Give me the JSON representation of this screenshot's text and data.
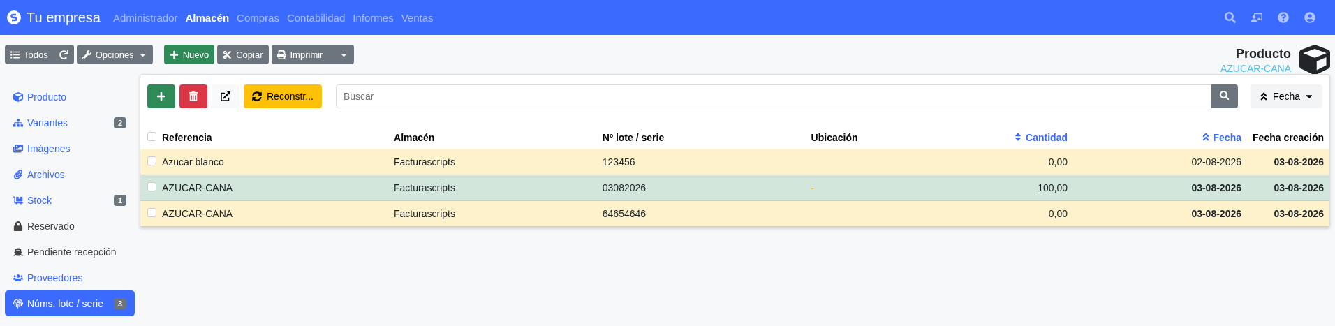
{
  "brand": {
    "name": "Tu empresa"
  },
  "menu": [
    {
      "label": "Administrador",
      "selected": false
    },
    {
      "label": "Almacén",
      "selected": true
    },
    {
      "label": "Compras",
      "selected": false
    },
    {
      "label": "Contabilidad",
      "selected": false
    },
    {
      "label": "Informes",
      "selected": false
    },
    {
      "label": "Ventas",
      "selected": false
    }
  ],
  "toolbar": [
    {
      "kind": "list",
      "label": "Todos"
    },
    {
      "kind": "options",
      "label": "Opciones"
    },
    {
      "kind": "new",
      "label": "Nuevo"
    },
    {
      "kind": "copy",
      "label": "Copiar"
    },
    {
      "kind": "print",
      "label": "Imprimir"
    }
  ],
  "header": {
    "title": "Producto",
    "subtitle": "AZUCAR-CANA"
  },
  "sidebar": {
    "items": [
      {
        "label": "Producto",
        "kind": "link",
        "selected": false
      },
      {
        "label": "Variantes",
        "kind": "link",
        "badge": "2",
        "selected": false
      },
      {
        "label": "Imágenes",
        "kind": "link",
        "selected": false
      },
      {
        "label": "Archivos",
        "kind": "link",
        "selected": false
      },
      {
        "label": "Stock",
        "kind": "link",
        "badge": "1",
        "selected": false
      },
      {
        "label": "Reservado",
        "kind": "text",
        "selected": false
      },
      {
        "label": "Pendiente recepción",
        "kind": "text",
        "selected": false
      },
      {
        "label": "Proveedores",
        "kind": "link",
        "selected": false
      },
      {
        "label": "Núms. lote / serie",
        "kind": "link",
        "badge": "3",
        "selected": true
      }
    ]
  },
  "panel": {
    "actions": [
      {
        "kind": "add"
      },
      {
        "kind": "delete"
      },
      {
        "kind": "export"
      },
      {
        "kind": "rebuild",
        "label": "Reconstr..."
      }
    ],
    "search": {
      "placeholder": "Buscar"
    },
    "order": {
      "label": "Fecha"
    },
    "table": {
      "select_all_checked": false,
      "columns": [
        {
          "label": "Referencia",
          "kind": "text",
          "sorted": false
        },
        {
          "label": "Almacén",
          "kind": "text",
          "sorted": false
        },
        {
          "label": "Nº lote / serie",
          "kind": "text",
          "sorted": false
        },
        {
          "label": "Ubicación",
          "kind": "text",
          "sorted": false
        },
        {
          "label": "Cantidad",
          "kind": "number",
          "sorted": true
        },
        {
          "label": "Fecha",
          "kind": "date",
          "sorted": true
        },
        {
          "label": "Fecha creación",
          "kind": "date",
          "sorted": false
        }
      ],
      "rows": [
        {
          "color": "#fdf2cc",
          "checked": false,
          "cells": [
            {
              "text": "Azucar blanco"
            },
            {
              "text": "Facturascripts"
            },
            {
              "text": "123456"
            },
            {},
            {
              "text": "0,00"
            },
            {
              "text": "02-08-2026",
              "bold": false
            },
            {
              "text": "03-08-2026",
              "bold": true
            }
          ]
        },
        {
          "color": "#d2e6dc",
          "checked": false,
          "cells": [
            {
              "text": "AZUCAR-CANA"
            },
            {
              "text": "Facturascripts"
            },
            {
              "text": "03082026"
            },
            {
              "text": "-",
              "muted": true
            },
            {
              "text": "100,00"
            },
            {
              "text": "03-08-2026",
              "bold": true
            },
            {
              "text": "03-08-2026",
              "bold": true
            }
          ]
        },
        {
          "color": "#fdf2cc",
          "checked": false,
          "cells": [
            {
              "text": "AZUCAR-CANA"
            },
            {
              "text": "Facturascripts"
            },
            {
              "text": "64654646"
            },
            {},
            {
              "text": "0,00"
            },
            {
              "text": "03-08-2026",
              "bold": true
            },
            {
              "text": "03-08-2026",
              "bold": true
            }
          ]
        }
      ]
    }
  }
}
